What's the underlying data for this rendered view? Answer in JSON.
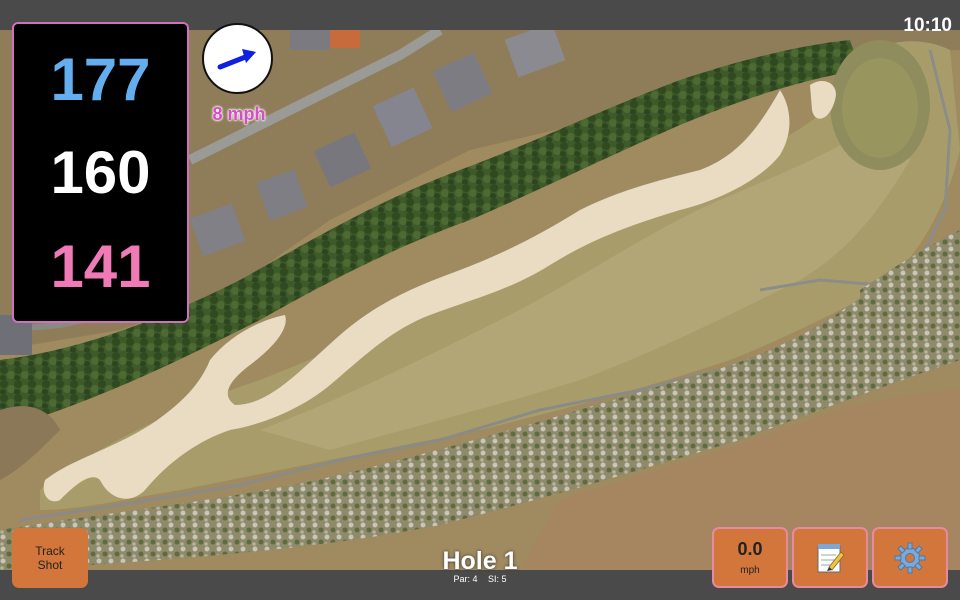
{
  "status": {
    "time": "10:10"
  },
  "distances": {
    "back": "177",
    "middle": "160",
    "front": "141"
  },
  "wind": {
    "speed_label": "8 mph",
    "icon": "arrow-right-icon"
  },
  "buttons": {
    "track_shot_line1": "Track",
    "track_shot_line2": "Shot",
    "speed_value": "0.0",
    "speed_unit": "mph",
    "notes_icon": "notepad-icon",
    "settings_icon": "gear-icon"
  },
  "hole": {
    "title": "Hole 1",
    "par_label": "Par: 4",
    "si_label": "SI: 5"
  },
  "colors": {
    "back": "#64aef0",
    "middle": "#ffffff",
    "front": "#f07ab6",
    "button": "#d2763c",
    "accent": "#d44ec4"
  }
}
